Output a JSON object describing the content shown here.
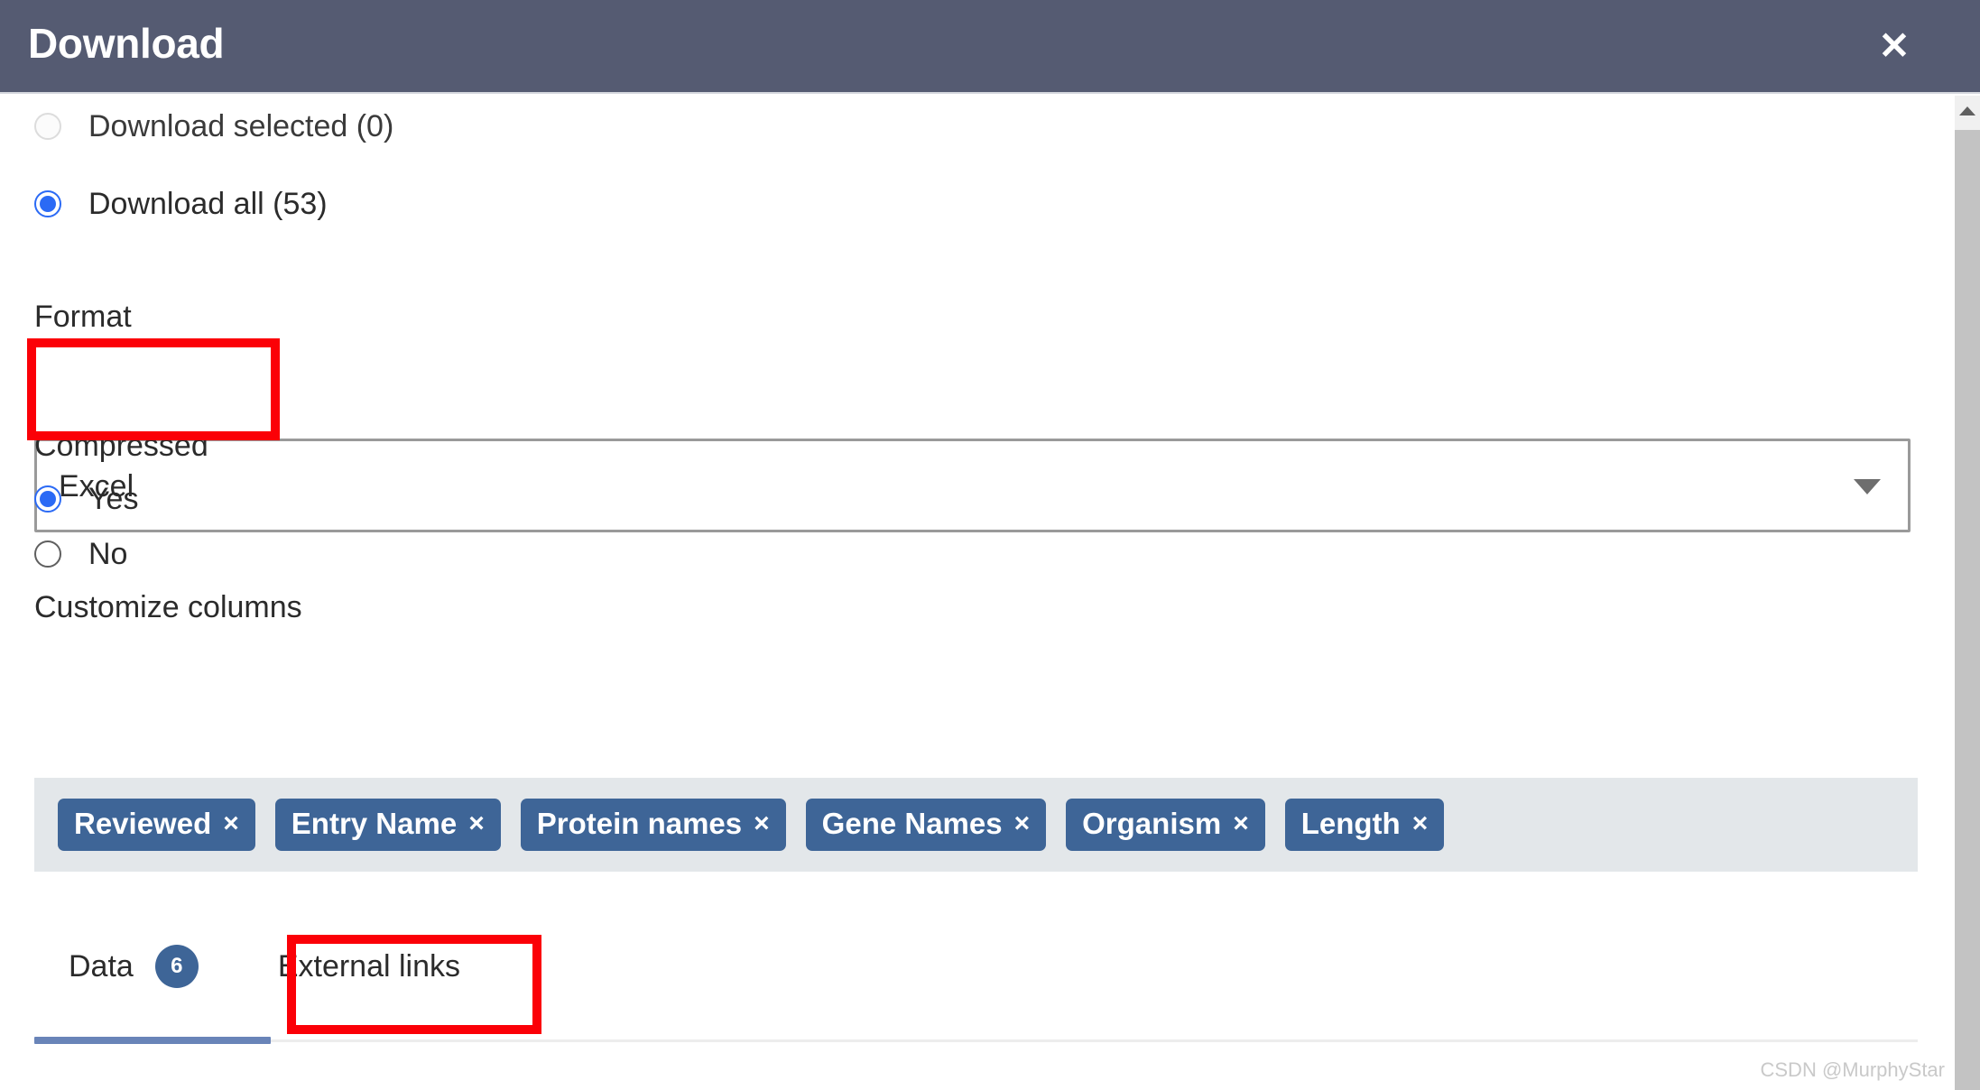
{
  "header": {
    "title": "Download",
    "close_label": "✕"
  },
  "scope": {
    "options": [
      {
        "label": "Download selected (0)",
        "selected": false,
        "disabled": true
      },
      {
        "label": "Download all (53)",
        "selected": true,
        "disabled": false
      }
    ]
  },
  "format": {
    "label": "Format",
    "selected_value": "Excel"
  },
  "compressed": {
    "label": "Compressed",
    "options": [
      {
        "label": "Yes",
        "selected": true
      },
      {
        "label": "No",
        "selected": false
      }
    ]
  },
  "customize_columns": {
    "label": "Customize columns",
    "tags": [
      {
        "label": "Reviewed",
        "remove": "×"
      },
      {
        "label": "Entry Name",
        "remove": "×"
      },
      {
        "label": "Protein names",
        "remove": "×"
      },
      {
        "label": "Gene Names",
        "remove": "×"
      },
      {
        "label": "Organism",
        "remove": "×"
      },
      {
        "label": "Length",
        "remove": "×"
      }
    ]
  },
  "tabs": [
    {
      "label": "Data",
      "badge": "6",
      "active": true
    },
    {
      "label": "External links",
      "badge": null,
      "active": false
    }
  ],
  "watermark": "CSDN @MurphyStar",
  "colors": {
    "header_background": "#555b72",
    "accent_blue": "#2b6af5",
    "tag_blue": "#3e6597",
    "tab_underline": "#6984b8",
    "tag_container_background": "#e3e7ea",
    "annotation_red": "#fb0007"
  }
}
